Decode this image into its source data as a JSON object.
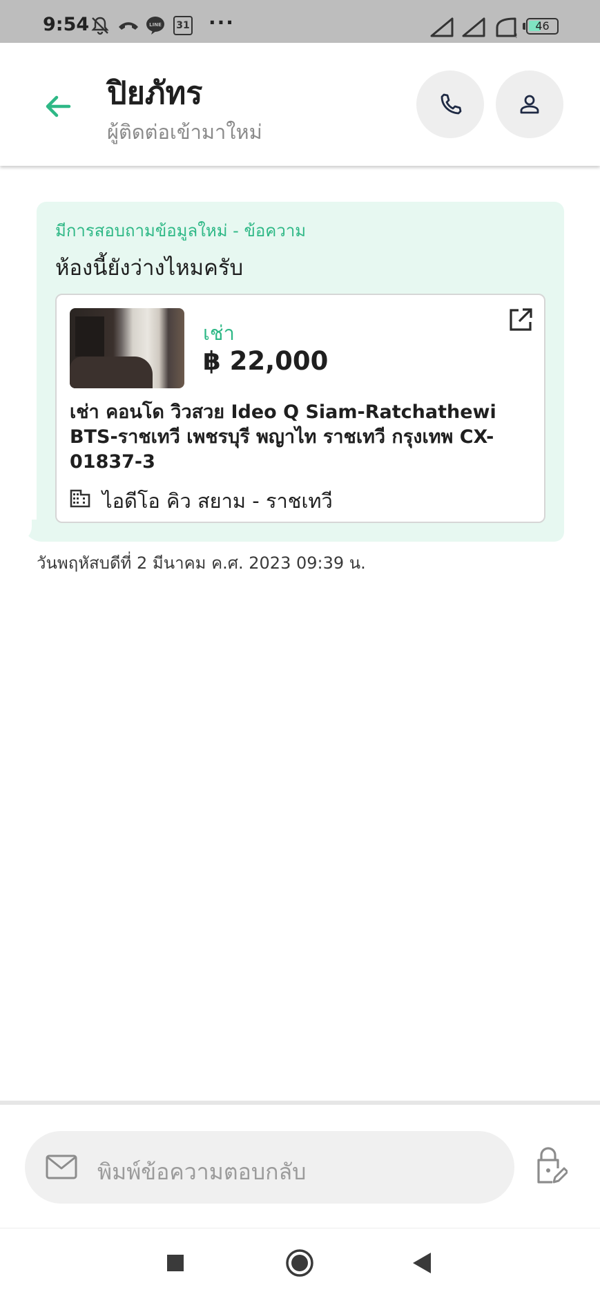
{
  "status_bar": {
    "time": "9:54",
    "calendar_day": "31",
    "more": "···",
    "battery_level": "46",
    "battery_fraction": 0.46,
    "icons": [
      "mute-bell-icon",
      "missed-call-icon",
      "line-app-icon",
      "calendar-icon",
      "more-icon",
      "signal-icon",
      "signal-icon",
      "wifi-icon",
      "battery-icon"
    ]
  },
  "header": {
    "contact_name": "ปิยภัทร",
    "contact_subtitle": "ผู้ติดต่อเข้ามาใหม่",
    "icons": [
      "back-arrow-icon",
      "phone-icon",
      "person-icon"
    ]
  },
  "message": {
    "label": "มีการสอบถามข้อมูลใหม่ - ข้อความ",
    "text": "ห้องนี้ยังว่างไหมครับ",
    "listing": {
      "type": "เช่า",
      "price": "฿ 22,000",
      "title": "เช่า คอนโด วิวสวย Ideo Q Siam-Ratchathewi BTS-ราชเทวี เพชรบุรี พญาไท ราชเทวี กรุงเทพ CX-01837-3",
      "building": "ไอดีโอ คิว สยาม - ราชเทวี"
    },
    "timestamp": "วันพฤหัสบดีที่ 2 มีนาคม ค.ศ. 2023 09:39 น."
  },
  "composer": {
    "placeholder": "พิมพ์ข้อความตอบกลับ"
  },
  "colors": {
    "accent": "#2eb886",
    "bubble": "#e7f8f1",
    "status_bar": "#bdbdbd"
  }
}
